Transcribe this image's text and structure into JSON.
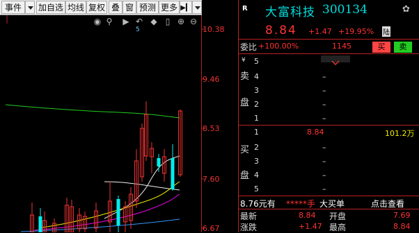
{
  "toolbar": {
    "events_label": "事件",
    "add_watchlist_label": "加自选",
    "ma_label": "均线",
    "adjust_label": "复权",
    "overlay_label": "叠",
    "window_label": "窗",
    "forecast_label": "预测",
    "more_label": "更多"
  },
  "price_axis": [
    "10.38",
    "9.46",
    "8.53",
    "7.60",
    "6.67"
  ],
  "stock": {
    "tag": "R",
    "name": "大富科技",
    "code": "300134",
    "price": "8.84",
    "change": "+1.47",
    "change_pct": "+19.95%",
    "board_tag": "陆"
  },
  "order_ratio": {
    "label": "委比",
    "ratio": "+100.00%",
    "diff": "1145",
    "buy_button": "买",
    "sell_button": "卖"
  },
  "sell_side": {
    "label_chars": [
      "卖",
      "盘"
    ],
    "currency_mark": "¥",
    "levels": [
      {
        "level": "5",
        "price": "",
        "volume": "–"
      },
      {
        "level": "4",
        "price": "",
        "volume": "–"
      },
      {
        "level": "3",
        "price": "",
        "volume": "–"
      },
      {
        "level": "2",
        "price": "",
        "volume": "–"
      },
      {
        "level": "1",
        "price": "",
        "volume": "–"
      }
    ]
  },
  "buy_side": {
    "label_chars": [
      "买",
      "盘"
    ],
    "levels": [
      {
        "level": "1",
        "price": "8.84",
        "volume": "101.2万"
      },
      {
        "level": "2",
        "price": "",
        "volume": "–"
      },
      {
        "level": "3",
        "price": "",
        "volume": "–"
      },
      {
        "level": "4",
        "price": "",
        "volume": "–"
      },
      {
        "level": "5",
        "price": "",
        "volume": "–"
      }
    ]
  },
  "big_order": {
    "amount": "8.76元有",
    "hidden": "*****手",
    "label": "大买单",
    "link": "点击查看"
  },
  "quote": {
    "latest_label": "最新",
    "latest_value": "8.84",
    "open_label": "开盘",
    "open_value": "7.69",
    "change_label": "涨跌",
    "change_value": "+1.47",
    "high_label": "最高",
    "high_value": "8.84"
  },
  "colors": {
    "up": "#ff3333",
    "down": "#00e5ee",
    "name": "#00dddd",
    "ma_white": "#ffffff",
    "ma_yellow": "#ffff00",
    "ma_magenta": "#ff00ff",
    "ma_green": "#00cc00"
  }
}
